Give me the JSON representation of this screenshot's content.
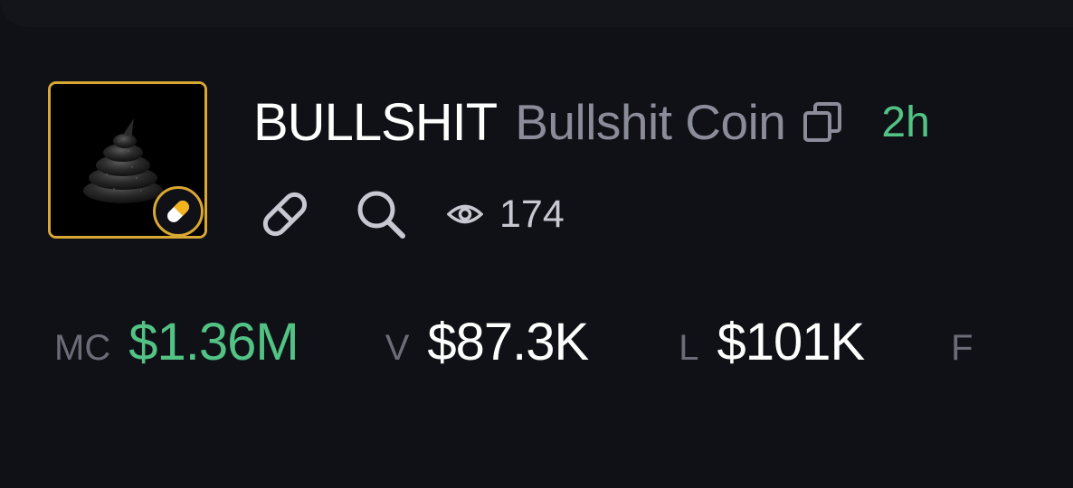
{
  "token": {
    "ticker": "BULLSHIT",
    "name": "Bullshit Coin",
    "age": "2h",
    "views": "174"
  },
  "stats": {
    "mc_label": "MC",
    "mc_value": "$1.36M",
    "v_label": "V",
    "v_value": "$87.3K",
    "l_label": "L",
    "l_value": "$101K",
    "cut_label": "F"
  },
  "icons": {
    "badge": "pill-icon",
    "copy": "copy-icon",
    "link": "link-icon",
    "search": "search-icon",
    "views": "eye-icon"
  },
  "colors": {
    "background": "#101116",
    "accent_gold": "#d9a733",
    "positive_green": "#52c285",
    "muted_text": "#8b8c99",
    "label_text": "#6b6c78"
  }
}
